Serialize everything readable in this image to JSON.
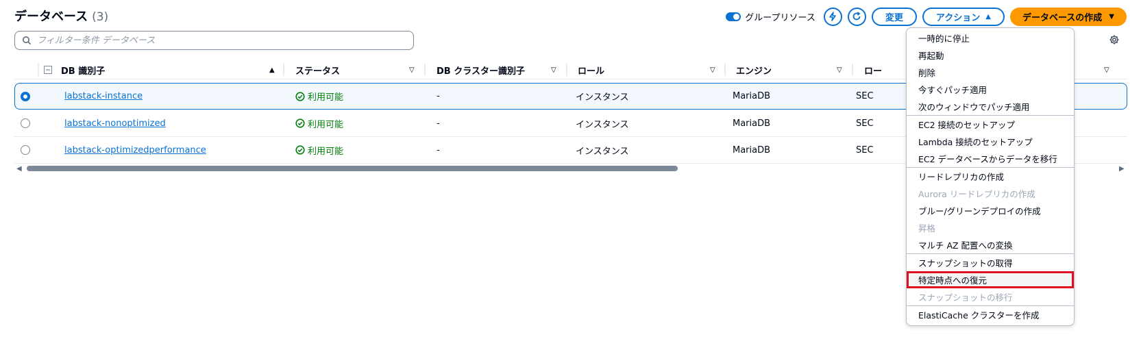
{
  "header": {
    "title": "データベース",
    "count": "(3)"
  },
  "toolbar": {
    "group_resources_label": "グループリソース",
    "modify_label": "変更",
    "actions_label": "アクション",
    "create_label": "データベースの作成"
  },
  "filter": {
    "placeholder": "フィルター条件 データベース"
  },
  "columns": {
    "db_id": "DB 識別子",
    "status": "ステータス",
    "cluster_id": "DB クラスター識別子",
    "role": "ロール",
    "engine": "エンジン",
    "region": "ロー"
  },
  "rows": [
    {
      "db_id": "labstack-instance",
      "status": "利用可能",
      "cluster_id": "-",
      "role": "インスタンス",
      "engine": "MariaDB",
      "region": "SEC",
      "selected": true
    },
    {
      "db_id": "labstack-nonoptimized",
      "status": "利用可能",
      "cluster_id": "-",
      "role": "インスタンス",
      "engine": "MariaDB",
      "region": "SEC",
      "selected": false
    },
    {
      "db_id": "labstack-optimizedperformance",
      "status": "利用可能",
      "cluster_id": "-",
      "role": "インスタンス",
      "engine": "MariaDB",
      "region": "SEC",
      "selected": false
    }
  ],
  "menu": {
    "items": [
      "一時的に停止",
      "再起動",
      "削除",
      "今すぐパッチ適用",
      "次のウィンドウでパッチ適用",
      "EC2 接続のセットアップ",
      "Lambda 接続のセットアップ",
      "EC2 データベースからデータを移行",
      "リードレプリカの作成",
      "Aurora リードレプリカの作成",
      "ブルー/グリーンデプロイの作成",
      "昇格",
      "マルチ AZ 配置への変換",
      "スナップショットの取得",
      "特定時点への復元",
      "スナップショットの移行",
      "ElastiCache クラスターを作成"
    ]
  },
  "colors": {
    "accent": "#0972d3",
    "primary_button": "#ff9900",
    "status_ok": "#037f0c",
    "highlight_border": "#e0101e",
    "disabled_text": "#9ba7b6"
  }
}
